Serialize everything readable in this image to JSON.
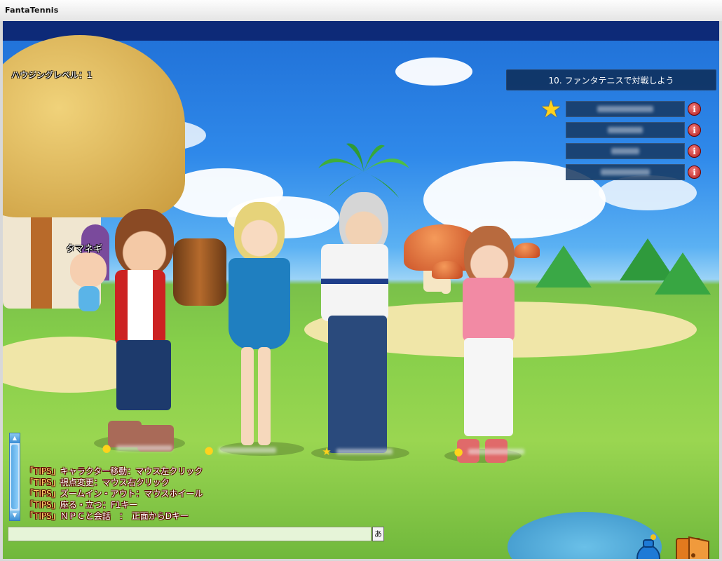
{
  "window": {
    "title": "FantaTennis"
  },
  "hud": {
    "housing_level": "ハウジングレベル：1",
    "quest": "10. ファンタテニスで対戦しよう",
    "party_leader_icon": "star-icon",
    "party_info_label": "i",
    "npc_name": "タマネギ"
  },
  "chat": {
    "lines": [
      {
        "tag": "「TIPS」",
        "text": "キャラクター移動：マウス左クリック"
      },
      {
        "tag": "「TIPS」",
        "text": "視点変更：マウス右クリック"
      },
      {
        "tag": "「TIPS」",
        "text": "ズームイン・アウト：マウスホイール"
      },
      {
        "tag": "「TIPS」",
        "text": "座る・立つ：F1キー"
      },
      {
        "tag": "「TIPS」",
        "text": "ＮＰＣと会話　：　正面からDキー"
      }
    ],
    "input_value": "",
    "ime_mode": "あ"
  },
  "colors": {
    "accent": "#0d2a78",
    "panel": "#16375f",
    "chat_tag": "#ffd86a"
  }
}
